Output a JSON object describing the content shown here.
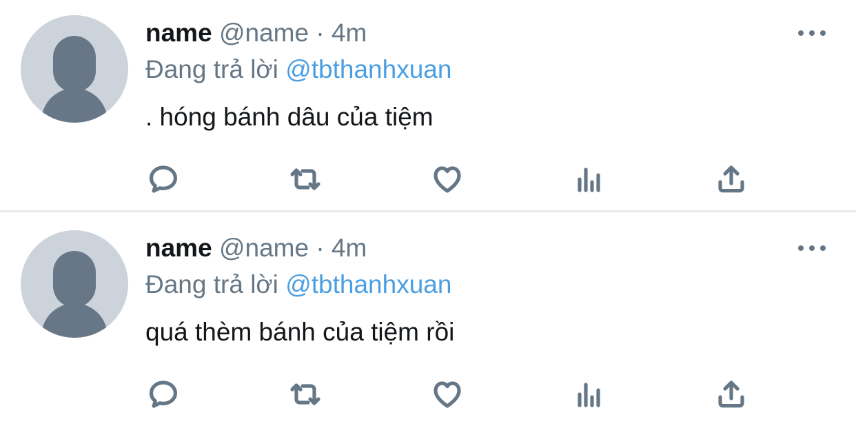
{
  "colors": {
    "text": "#14171a",
    "secondary": "#657786",
    "mention": "#4a9ee2",
    "avatar_bg": "#ccd3da",
    "avatar_fg": "#687787",
    "divider": "#e6e9ec"
  },
  "tweets": [
    {
      "name": "name",
      "handle": "@name",
      "separator": "·",
      "time": "4m",
      "replying_label": "Đang trả lời",
      "replying_to": "@tbthanhxuan",
      "text": ". hóng bánh dâu của tiệm",
      "icons": [
        "avatar-placeholder",
        "more-icon",
        "reply-icon",
        "retweet-icon",
        "like-icon",
        "views-icon",
        "share-icon"
      ]
    },
    {
      "name": "name",
      "handle": "@name",
      "separator": "·",
      "time": "4m",
      "replying_label": "Đang trả lời",
      "replying_to": "@tbthanhxuan",
      "text": "quá thèm bánh của tiệm rồi",
      "icons": [
        "avatar-placeholder",
        "more-icon",
        "reply-icon",
        "retweet-icon",
        "like-icon",
        "views-icon",
        "share-icon"
      ]
    }
  ]
}
